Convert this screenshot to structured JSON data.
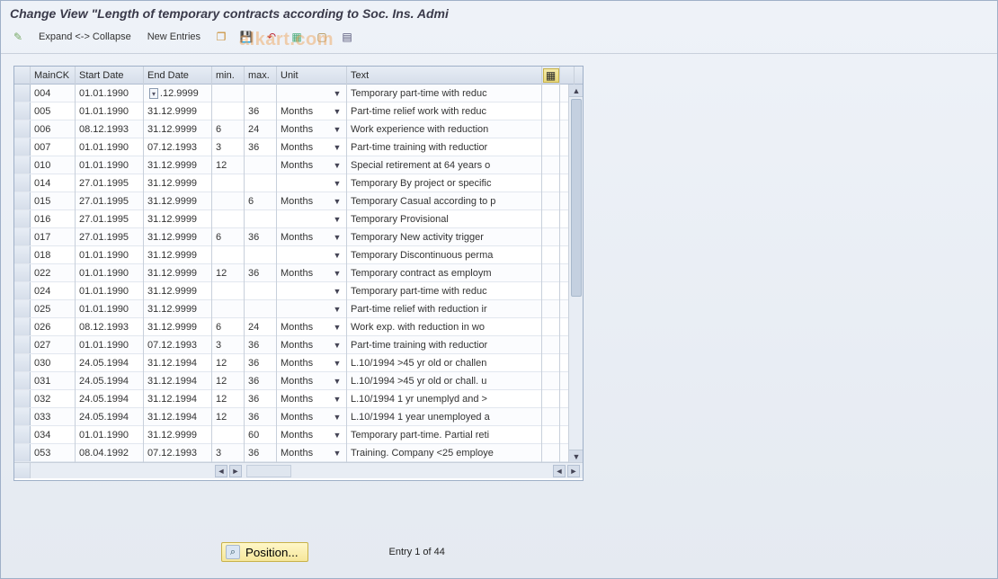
{
  "title": "Change View \"Length of temporary contracts according to Soc. Ins. Admi",
  "watermark": "alkart.com",
  "toolbar": {
    "expand_collapse": "Expand <-> Collapse",
    "new_entries": "New Entries"
  },
  "columns": {
    "mainck": "MainCK",
    "start_date": "Start Date",
    "end_date": "End Date",
    "min": "min.",
    "max": "max.",
    "unit": "Unit",
    "text": "Text"
  },
  "rows": [
    {
      "ck": "004",
      "sd": "01.01.1990",
      "ed": ".12.9999",
      "min": "",
      "max": "",
      "unit": "",
      "text": "Temporary part-time with reduc",
      "date_help": true
    },
    {
      "ck": "005",
      "sd": "01.01.1990",
      "ed": "31.12.9999",
      "min": "",
      "max": "36",
      "unit": "Months",
      "text": "Part-time relief work with reduc"
    },
    {
      "ck": "006",
      "sd": "08.12.1993",
      "ed": "31.12.9999",
      "min": "6",
      "max": "24",
      "unit": "Months",
      "text": "Work experience with reduction"
    },
    {
      "ck": "007",
      "sd": "01.01.1990",
      "ed": "07.12.1993",
      "min": "3",
      "max": "36",
      "unit": "Months",
      "text": "Part-time training with reductior"
    },
    {
      "ck": "010",
      "sd": "01.01.1990",
      "ed": "31.12.9999",
      "min": "12",
      "max": "",
      "unit": "Months",
      "text": "Special retirement at 64 years o"
    },
    {
      "ck": "014",
      "sd": "27.01.1995",
      "ed": "31.12.9999",
      "min": "",
      "max": "",
      "unit": "",
      "text": "Temporary By project or specific"
    },
    {
      "ck": "015",
      "sd": "27.01.1995",
      "ed": "31.12.9999",
      "min": "",
      "max": "6",
      "unit": "Months",
      "text": "Temporary Casual according to p"
    },
    {
      "ck": "016",
      "sd": "27.01.1995",
      "ed": "31.12.9999",
      "min": "",
      "max": "",
      "unit": "",
      "text": "Temporary Provisional"
    },
    {
      "ck": "017",
      "sd": "27.01.1995",
      "ed": "31.12.9999",
      "min": "6",
      "max": "36",
      "unit": "Months",
      "text": "Temporary New activity trigger"
    },
    {
      "ck": "018",
      "sd": "01.01.1990",
      "ed": "31.12.9999",
      "min": "",
      "max": "",
      "unit": "",
      "text": "Temporary Discontinuous perma"
    },
    {
      "ck": "022",
      "sd": "01.01.1990",
      "ed": "31.12.9999",
      "min": "12",
      "max": "36",
      "unit": "Months",
      "text": "Temporary contract as employm"
    },
    {
      "ck": "024",
      "sd": "01.01.1990",
      "ed": "31.12.9999",
      "min": "",
      "max": "",
      "unit": "",
      "text": "Temporary part-time with reduc"
    },
    {
      "ck": "025",
      "sd": "01.01.1990",
      "ed": "31.12.9999",
      "min": "",
      "max": "",
      "unit": "",
      "text": "Part-time relief with reduction ir"
    },
    {
      "ck": "026",
      "sd": "08.12.1993",
      "ed": "31.12.9999",
      "min": "6",
      "max": "24",
      "unit": "Months",
      "text": "Work exp. with reduction in wo"
    },
    {
      "ck": "027",
      "sd": "01.01.1990",
      "ed": "07.12.1993",
      "min": "3",
      "max": "36",
      "unit": "Months",
      "text": "Part-time training with reductior"
    },
    {
      "ck": "030",
      "sd": "24.05.1994",
      "ed": "31.12.1994",
      "min": "12",
      "max": "36",
      "unit": "Months",
      "text": "L.10/1994 >45 yr old or challen"
    },
    {
      "ck": "031",
      "sd": "24.05.1994",
      "ed": "31.12.1994",
      "min": "12",
      "max": "36",
      "unit": "Months",
      "text": "L.10/1994 >45 yr old or chall. u"
    },
    {
      "ck": "032",
      "sd": "24.05.1994",
      "ed": "31.12.1994",
      "min": "12",
      "max": "36",
      "unit": "Months",
      "text": "L.10/1994 1 yr unemplyd and >"
    },
    {
      "ck": "033",
      "sd": "24.05.1994",
      "ed": "31.12.1994",
      "min": "12",
      "max": "36",
      "unit": "Months",
      "text": "L.10/1994 1 year unemployed a"
    },
    {
      "ck": "034",
      "sd": "01.01.1990",
      "ed": "31.12.9999",
      "min": "",
      "max": "60",
      "unit": "Months",
      "text": "Temporary part-time. Partial reti"
    },
    {
      "ck": "053",
      "sd": "08.04.1992",
      "ed": "07.12.1993",
      "min": "3",
      "max": "36",
      "unit": "Months",
      "text": "Training. Company <25 employe"
    }
  ],
  "footer": {
    "position_label": "Position...",
    "entry_text": "Entry 1 of 44"
  }
}
